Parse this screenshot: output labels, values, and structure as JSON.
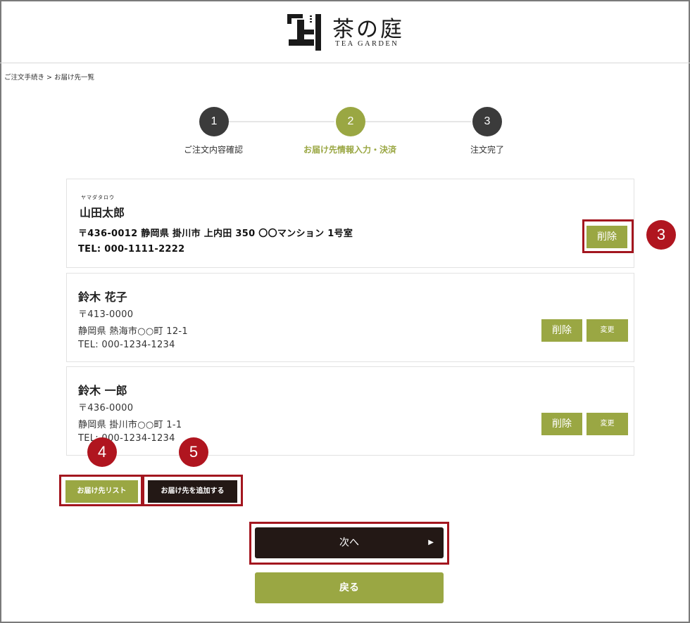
{
  "header": {
    "brand_jp": "茶の庭",
    "brand_en": "TEA GARDEN",
    "logo_icon": "brand-mark-icon"
  },
  "breadcrumb": "ご注文手続き > お届け先一覧",
  "steps": [
    {
      "number": "1",
      "label": "ご注文内容確認",
      "state": "done"
    },
    {
      "number": "2",
      "label": "お届け先情報入力・決済",
      "state": "active"
    },
    {
      "number": "3",
      "label": "注文完了",
      "state": "pending"
    }
  ],
  "addresses": [
    {
      "furigana": "ヤマダタロウ",
      "name": "山田太郎",
      "postal_address": "〒436-0012 静岡県 掛川市 上内田 350 〇〇マンション 1号室",
      "phone": "TEL: 000-1111-2222",
      "delete_label": "削除"
    },
    {
      "name": "鈴木 花子",
      "postal": "〒413-0000",
      "address": "静岡県 熱海市○○町 12-1",
      "phone": "TEL: 000-1234-1234",
      "delete_label": "削除",
      "change_label": "変更"
    },
    {
      "name": "鈴木 一郎",
      "postal": "〒436-0000",
      "address": "静岡県 掛川市○○町 1-1",
      "phone": "TEL: 000-1234-1234",
      "delete_label": "削除",
      "change_label": "変更"
    }
  ],
  "actions": {
    "address_list_label": "お届け先リスト",
    "add_address_label": "お届け先を追加する",
    "next_label": "次へ",
    "next_arrow": "▶",
    "back_label": "戻る"
  },
  "annotations": [
    "3",
    "4",
    "5"
  ],
  "colors": {
    "accent": "#9aa743",
    "dark": "#231815",
    "highlight": "#a3161f",
    "badge": "#b0151f"
  }
}
